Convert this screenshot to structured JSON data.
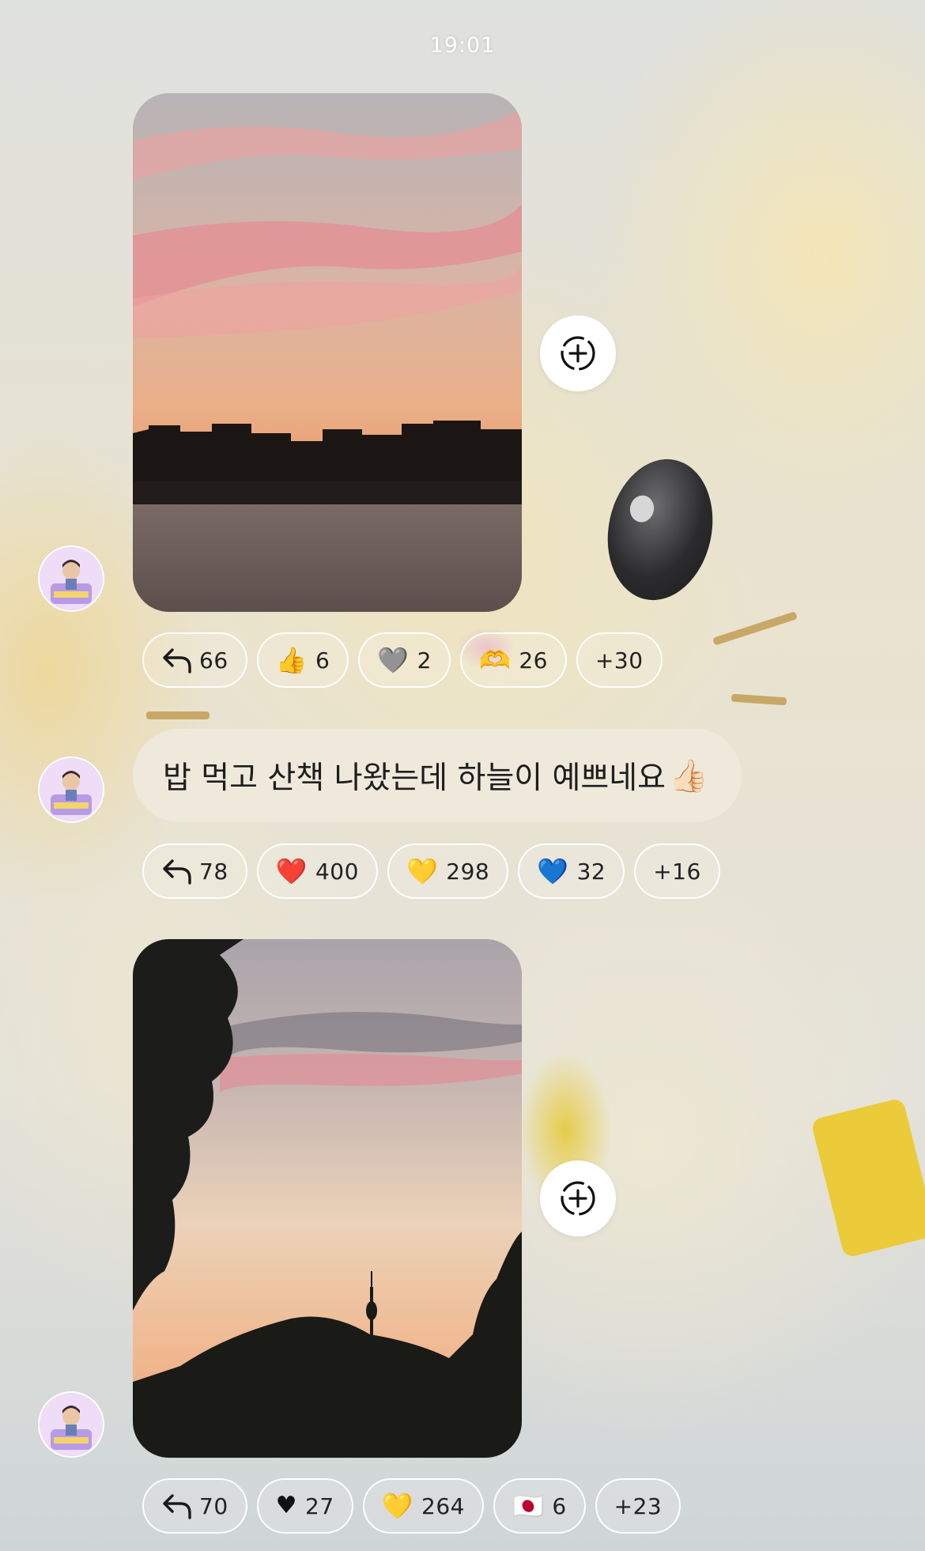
{
  "status_bar": {
    "time": "19:01"
  },
  "messages": [
    {
      "type": "photo",
      "photo_label": "sunset-over-river-photo",
      "reactions": [
        {
          "icon": "reply-arrow-icon",
          "glyph": "",
          "count": "66"
        },
        {
          "icon": "thumbs-up-emoji",
          "glyph": "👍",
          "count": "6"
        },
        {
          "icon": "grey-heart-emoji",
          "glyph": "🩶",
          "count": "2"
        },
        {
          "icon": "heart-hands-emoji",
          "glyph": "🫶",
          "count": "26"
        },
        {
          "icon": "more-reactions",
          "glyph": "",
          "count": "+30"
        }
      ]
    },
    {
      "type": "text",
      "text": "밥 먹고 산책 나왔는데 하늘이 예쁘네요",
      "trailing_emoji": "👍🏻",
      "reactions": [
        {
          "icon": "reply-arrow-icon",
          "glyph": "",
          "count": "78"
        },
        {
          "icon": "red-heart-emoji",
          "glyph": "❤️",
          "count": "400"
        },
        {
          "icon": "yellow-heart-emoji",
          "glyph": "💛",
          "count": "298"
        },
        {
          "icon": "blue-heart-emoji",
          "glyph": "💙",
          "count": "32"
        },
        {
          "icon": "more-reactions",
          "glyph": "",
          "count": "+16"
        }
      ]
    },
    {
      "type": "photo",
      "photo_label": "sunset-tower-silhouette-photo",
      "reactions": [
        {
          "icon": "reply-arrow-icon",
          "glyph": "",
          "count": "70"
        },
        {
          "icon": "black-heart-icon",
          "glyph": "♥",
          "count": "27"
        },
        {
          "icon": "yellow-heart-emoji",
          "glyph": "💛",
          "count": "264"
        },
        {
          "icon": "japan-flag-emoji",
          "glyph": "🇯🇵",
          "count": "6"
        },
        {
          "icon": "more-reactions",
          "glyph": "",
          "count": "+23"
        }
      ]
    }
  ],
  "colors": {
    "bubble_bg": "#efe9dc",
    "pill_border": "#ffffff",
    "text": "#222222"
  }
}
